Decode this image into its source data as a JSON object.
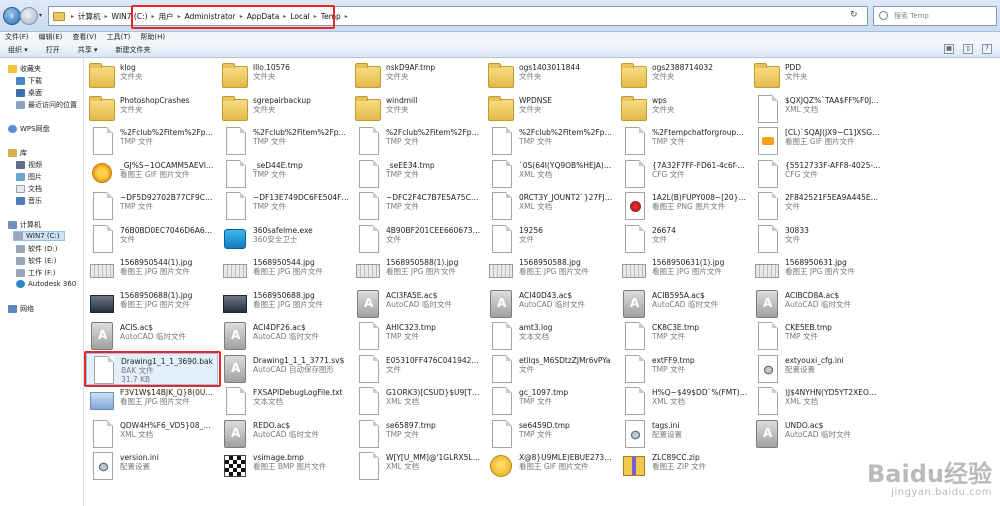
{
  "address": {
    "crumbs": [
      "计算机",
      "WIN7 (C:)",
      "用户",
      "Administrator",
      "AppData",
      "Local",
      "Temp"
    ],
    "search_placeholder": "搜索 Temp"
  },
  "menu": [
    "文件(F)",
    "编辑(E)",
    "查看(V)",
    "工具(T)",
    "帮助(H)"
  ],
  "toolbar": [
    "组织 ▾",
    "打开",
    "共享 ▾",
    "新建文件夹"
  ],
  "sidebar": {
    "favorites": "收藏夹",
    "fav_items": [
      "下载",
      "桌面",
      "最近访问的位置"
    ],
    "wps": "WPS网盘",
    "libraries": "库",
    "lib_items": [
      "视频",
      "图片",
      "文档",
      "音乐"
    ],
    "computer": "计算机",
    "drives": [
      "WIN7 (C:)",
      "软件 (D:)",
      "软件 (E:)",
      "工作 (F:)",
      "Autodesk 360"
    ],
    "network": "网络"
  },
  "columns": [
    [
      {
        "name": "klog",
        "sub": "文件夹",
        "icon": "folder-icon"
      },
      {
        "name": "PhotoshopCrashes",
        "sub": "文件夹",
        "icon": "folder-icon"
      },
      {
        "name": "%2Fclub%2Fitem%2Fparcel%2F%2F1ed8842212a5c8564051...",
        "sub": "TMP 文件",
        "icon": "file-icon"
      },
      {
        "name": "_GJ%S~1OCAMM5AEVI[TU8%M.gif",
        "sub": "看图王 GIF 图片文件",
        "icon": "sun-icon"
      },
      {
        "name": "~DF5D92702B77CF9C82.TMP",
        "sub": "TMP 文件",
        "icon": "file-icon"
      },
      {
        "name": "76B0BD0EC7046D6A6DBAA26E5D4532710692C5818CE4A8F1...",
        "sub": "文件",
        "icon": "file-icon"
      },
      {
        "name": "1568950544(1).jpg",
        "sub": "看图王 JPG 图片文件",
        "icon": "strip-icon"
      },
      {
        "name": "1568950688(1).jpg",
        "sub": "看图王 JPG 图片文件",
        "icon": "dark-image-icon"
      },
      {
        "name": "ACIS.ac$",
        "sub": "AutoCAD 临时文件",
        "icon": "autocad-icon"
      },
      {
        "name": "Drawing1_1_1_3690.bak",
        "sub": "BAK 文件",
        "sub2": "31.7 KB",
        "icon": "file-icon",
        "selected": true
      },
      {
        "name": "F3V1W$14BJK_Q}8(0U72JV.jpg",
        "sub": "看图王 JPG 图片文件",
        "icon": "image-icon"
      },
      {
        "name": "QDW4H%F6_VD5}08_GARX46J.xml",
        "sub": "XML 文档",
        "icon": "file-icon"
      },
      {
        "name": "version.ini",
        "sub": "配置设置",
        "icon": "ini-icon"
      }
    ],
    [
      {
        "name": "lllo.10576",
        "sub": "文件夹",
        "icon": "folder-icon"
      },
      {
        "name": "sgrepairbackup",
        "sub": "文件夹",
        "icon": "folder-icon"
      },
      {
        "name": "%2Fclub%2Fitem%2Fparcel%2F%2F4%2Fa04e2c6176a2a9d3b8fb5...",
        "sub": "TMP 文件",
        "icon": "file-icon"
      },
      {
        "name": "_seD44E.tmp",
        "sub": "TMP 文件",
        "icon": "file-icon"
      },
      {
        "name": "~DF13E749DC6FE504F4.TMP",
        "sub": "TMP 文件",
        "icon": "file-icon"
      },
      {
        "name": "360safelme.exe",
        "sub": "360安全卫士",
        "icon": "exe-icon"
      },
      {
        "name": "1568950544.jpg",
        "sub": "看图王 JPG 图片文件",
        "icon": "strip-icon"
      },
      {
        "name": "1568950688.jpg",
        "sub": "看图王 JPG 图片文件",
        "icon": "dark-image-icon"
      },
      {
        "name": "ACI4DF26.ac$",
        "sub": "AutoCAD 临时文件",
        "icon": "autocad-icon"
      },
      {
        "name": "Drawing1_1_1_3771.sv$",
        "sub": "AutoCAD 自动保存图形",
        "icon": "autocad-icon"
      },
      {
        "name": "FXSAPIDebugLogFile.txt",
        "sub": "文本文档",
        "icon": "file-icon"
      },
      {
        "name": "REDO.ac$",
        "sub": "AutoCAD 临时文件",
        "icon": "autocad-icon"
      },
      {
        "name": "vsimage.bmp",
        "sub": "看图王 BMP 图片文件",
        "icon": "checker-icon"
      }
    ],
    [
      {
        "name": "nskD9AF.tmp",
        "sub": "文件夹",
        "icon": "folder-icon"
      },
      {
        "name": "windmill",
        "sub": "文件夹",
        "icon": "folder-icon"
      },
      {
        "name": "%2Fclub%2Fitem%2Fparcel%2F%2F8%2F8f1ef39ca0b4b1dcf1ed4...",
        "sub": "TMP 文件",
        "icon": "file-icon"
      },
      {
        "name": "_seEE34.tmp",
        "sub": "TMP 文件",
        "icon": "file-icon"
      },
      {
        "name": "~DFC2F4C7B7E5A75C45.TMP",
        "sub": "TMP 文件",
        "icon": "file-icon"
      },
      {
        "name": "4B90BF201CEE660673C91DBE6E2B5BF75FF5BA82E107588B722...",
        "sub": "文件",
        "icon": "file-icon"
      },
      {
        "name": "1568950588(1).jpg",
        "sub": "看图王 JPG 图片文件",
        "icon": "strip-icon"
      },
      {
        "name": "ACI3FA5E.ac$",
        "sub": "AutoCAD 临时文件",
        "icon": "autocad-icon"
      },
      {
        "name": "AHIC323.tmp",
        "sub": "TMP 文件",
        "icon": "file-icon"
      },
      {
        "name": "E05310FF476C041942CF1E177CCEC7A1E1E3C382A2248834...",
        "sub": "文件",
        "icon": "file-icon"
      },
      {
        "name": "G1ORK3)[CSUD}$U9[TG'96N.xml",
        "sub": "XML 文档",
        "icon": "file-icon"
      },
      {
        "name": "se65897.tmp",
        "sub": "TMP 文件",
        "icon": "file-icon"
      },
      {
        "name": "W[Y[U_MM]@'1GLRX5L53I(V.xml",
        "sub": "XML 文档",
        "icon": "file-icon"
      }
    ],
    [
      {
        "name": "ogs1403011844",
        "sub": "文件夹",
        "icon": "folder-icon"
      },
      {
        "name": "WPDNSE",
        "sub": "文件夹",
        "icon": "folder-icon"
      },
      {
        "name": "%2Fclub%2Fitem%2Fparcel%2F%2F4%2Fa2921772539883 0e27e81...",
        "sub": "TMP 文件",
        "icon": "file-icon"
      },
      {
        "name": "`0S(64I(YQ9OB%HEJA)WT%4.xml",
        "sub": "XML 文档",
        "icon": "file-icon"
      },
      {
        "name": "0RCT3Y_JOUNT2`}27FJ9U`R.xml",
        "sub": "XML 文档",
        "icon": "file-icon"
      },
      {
        "name": "19256",
        "sub": "文件",
        "icon": "file-icon"
      },
      {
        "name": "1568950588.jpg",
        "sub": "看图王 JPG 图片文件",
        "icon": "strip-icon"
      },
      {
        "name": "ACI40D43.ac$",
        "sub": "AutoCAD 临时文件",
        "icon": "autocad-icon"
      },
      {
        "name": "amt3.log",
        "sub": "文本文档",
        "icon": "file-icon"
      },
      {
        "name": "etilqs_M6SDtzZJMr6vPYa",
        "sub": "文件",
        "icon": "file-icon"
      },
      {
        "name": "gc_1097.tmp",
        "sub": "TMP 文件",
        "icon": "file-icon"
      },
      {
        "name": "se6459D.tmp",
        "sub": "TMP 文件",
        "icon": "file-icon"
      },
      {
        "name": "X@8}U9MLE)EBUE273}9PGF.gif",
        "sub": "看图王 GIF 图片文件",
        "icon": "smile-icon"
      }
    ],
    [
      {
        "name": "ogs2388714032",
        "sub": "文件夹",
        "icon": "folder-icon"
      },
      {
        "name": "wps",
        "sub": "文件夹",
        "icon": "folder-icon"
      },
      {
        "name": "%2Ftempchatforgroup%2Fsecure%2Fget_url_whitelist_5d841da...",
        "sub": "TMP 文件",
        "icon": "file-icon"
      },
      {
        "name": "{7A32F7FF-FD61-4c6f-BDC9-D9AB2176A397}.cfg",
        "sub": "CFG 文件",
        "icon": "file-icon"
      },
      {
        "name": "1A2L(B)FUPY008~[20}014A.png",
        "sub": "看图王 PNG 图片文件",
        "icon": "png-icon"
      },
      {
        "name": "26674",
        "sub": "文件",
        "icon": "file-icon"
      },
      {
        "name": "1568950631(1).jpg",
        "sub": "看图王 JPG 图片文件",
        "icon": "strip-icon"
      },
      {
        "name": "ACIB595A.ac$",
        "sub": "AutoCAD 临时文件",
        "icon": "autocad-icon"
      },
      {
        "name": "CK8C3E.tmp",
        "sub": "TMP 文件",
        "icon": "file-icon"
      },
      {
        "name": "extFF9.tmp",
        "sub": "TMP 文件",
        "icon": "file-icon"
      },
      {
        "name": "H%Q~$49$DD`%(FMT)4@)RP.xml",
        "sub": "XML 文档",
        "icon": "file-icon"
      },
      {
        "name": "tags.ini",
        "sub": "配置设置",
        "icon": "ini-icon"
      },
      {
        "name": "ZLC89CC.zip",
        "sub": "看图王 ZIP 文件",
        "icon": "zip-icon"
      }
    ],
    [
      {
        "name": "PDD",
        "sub": "文件夹",
        "icon": "folder-icon"
      },
      {
        "name": "$QXJQZ%`TAA$FF%F0JRYSAA.xml",
        "sub": "XML 文档",
        "icon": "file-icon"
      },
      {
        "name": "[CL)`SQAJ(JX9~C1]XSG0F0.gif",
        "sub": "看图王 GIF 图片文件",
        "icon": "gif-icon"
      },
      {
        "name": "{5512733F-AFF8-4025-ACBE-005FA2B538F2}.cfg",
        "sub": "CFG 文件",
        "icon": "file-icon"
      },
      {
        "name": "2F842521F5EA9A445E863461D8F2A7E164CECA662D94481A35...",
        "sub": "文件",
        "icon": "file-icon"
      },
      {
        "name": "30833",
        "sub": "文件",
        "icon": "file-icon"
      },
      {
        "name": "1568950631.jpg",
        "sub": "看图王 JPG 图片文件",
        "icon": "strip-icon"
      },
      {
        "name": "ACIBCD8A.ac$",
        "sub": "AutoCAD 临时文件",
        "icon": "autocad-icon"
      },
      {
        "name": "CKE5EB.tmp",
        "sub": "TMP 文件",
        "icon": "file-icon"
      },
      {
        "name": "extyouxi_cfg.ini",
        "sub": "配置设置",
        "icon": "ini-icon"
      },
      {
        "name": ")J$4NYHN(YD5YT2XEOQUQND.xml",
        "sub": "XML 文档",
        "icon": "file-icon"
      },
      {
        "name": "UNDO.ac$",
        "sub": "AutoCAD 临时文件",
        "icon": "autocad-icon"
      }
    ]
  ],
  "watermark": {
    "logo": "Baidu经验",
    "url": "jingyan.baidu.com"
  }
}
